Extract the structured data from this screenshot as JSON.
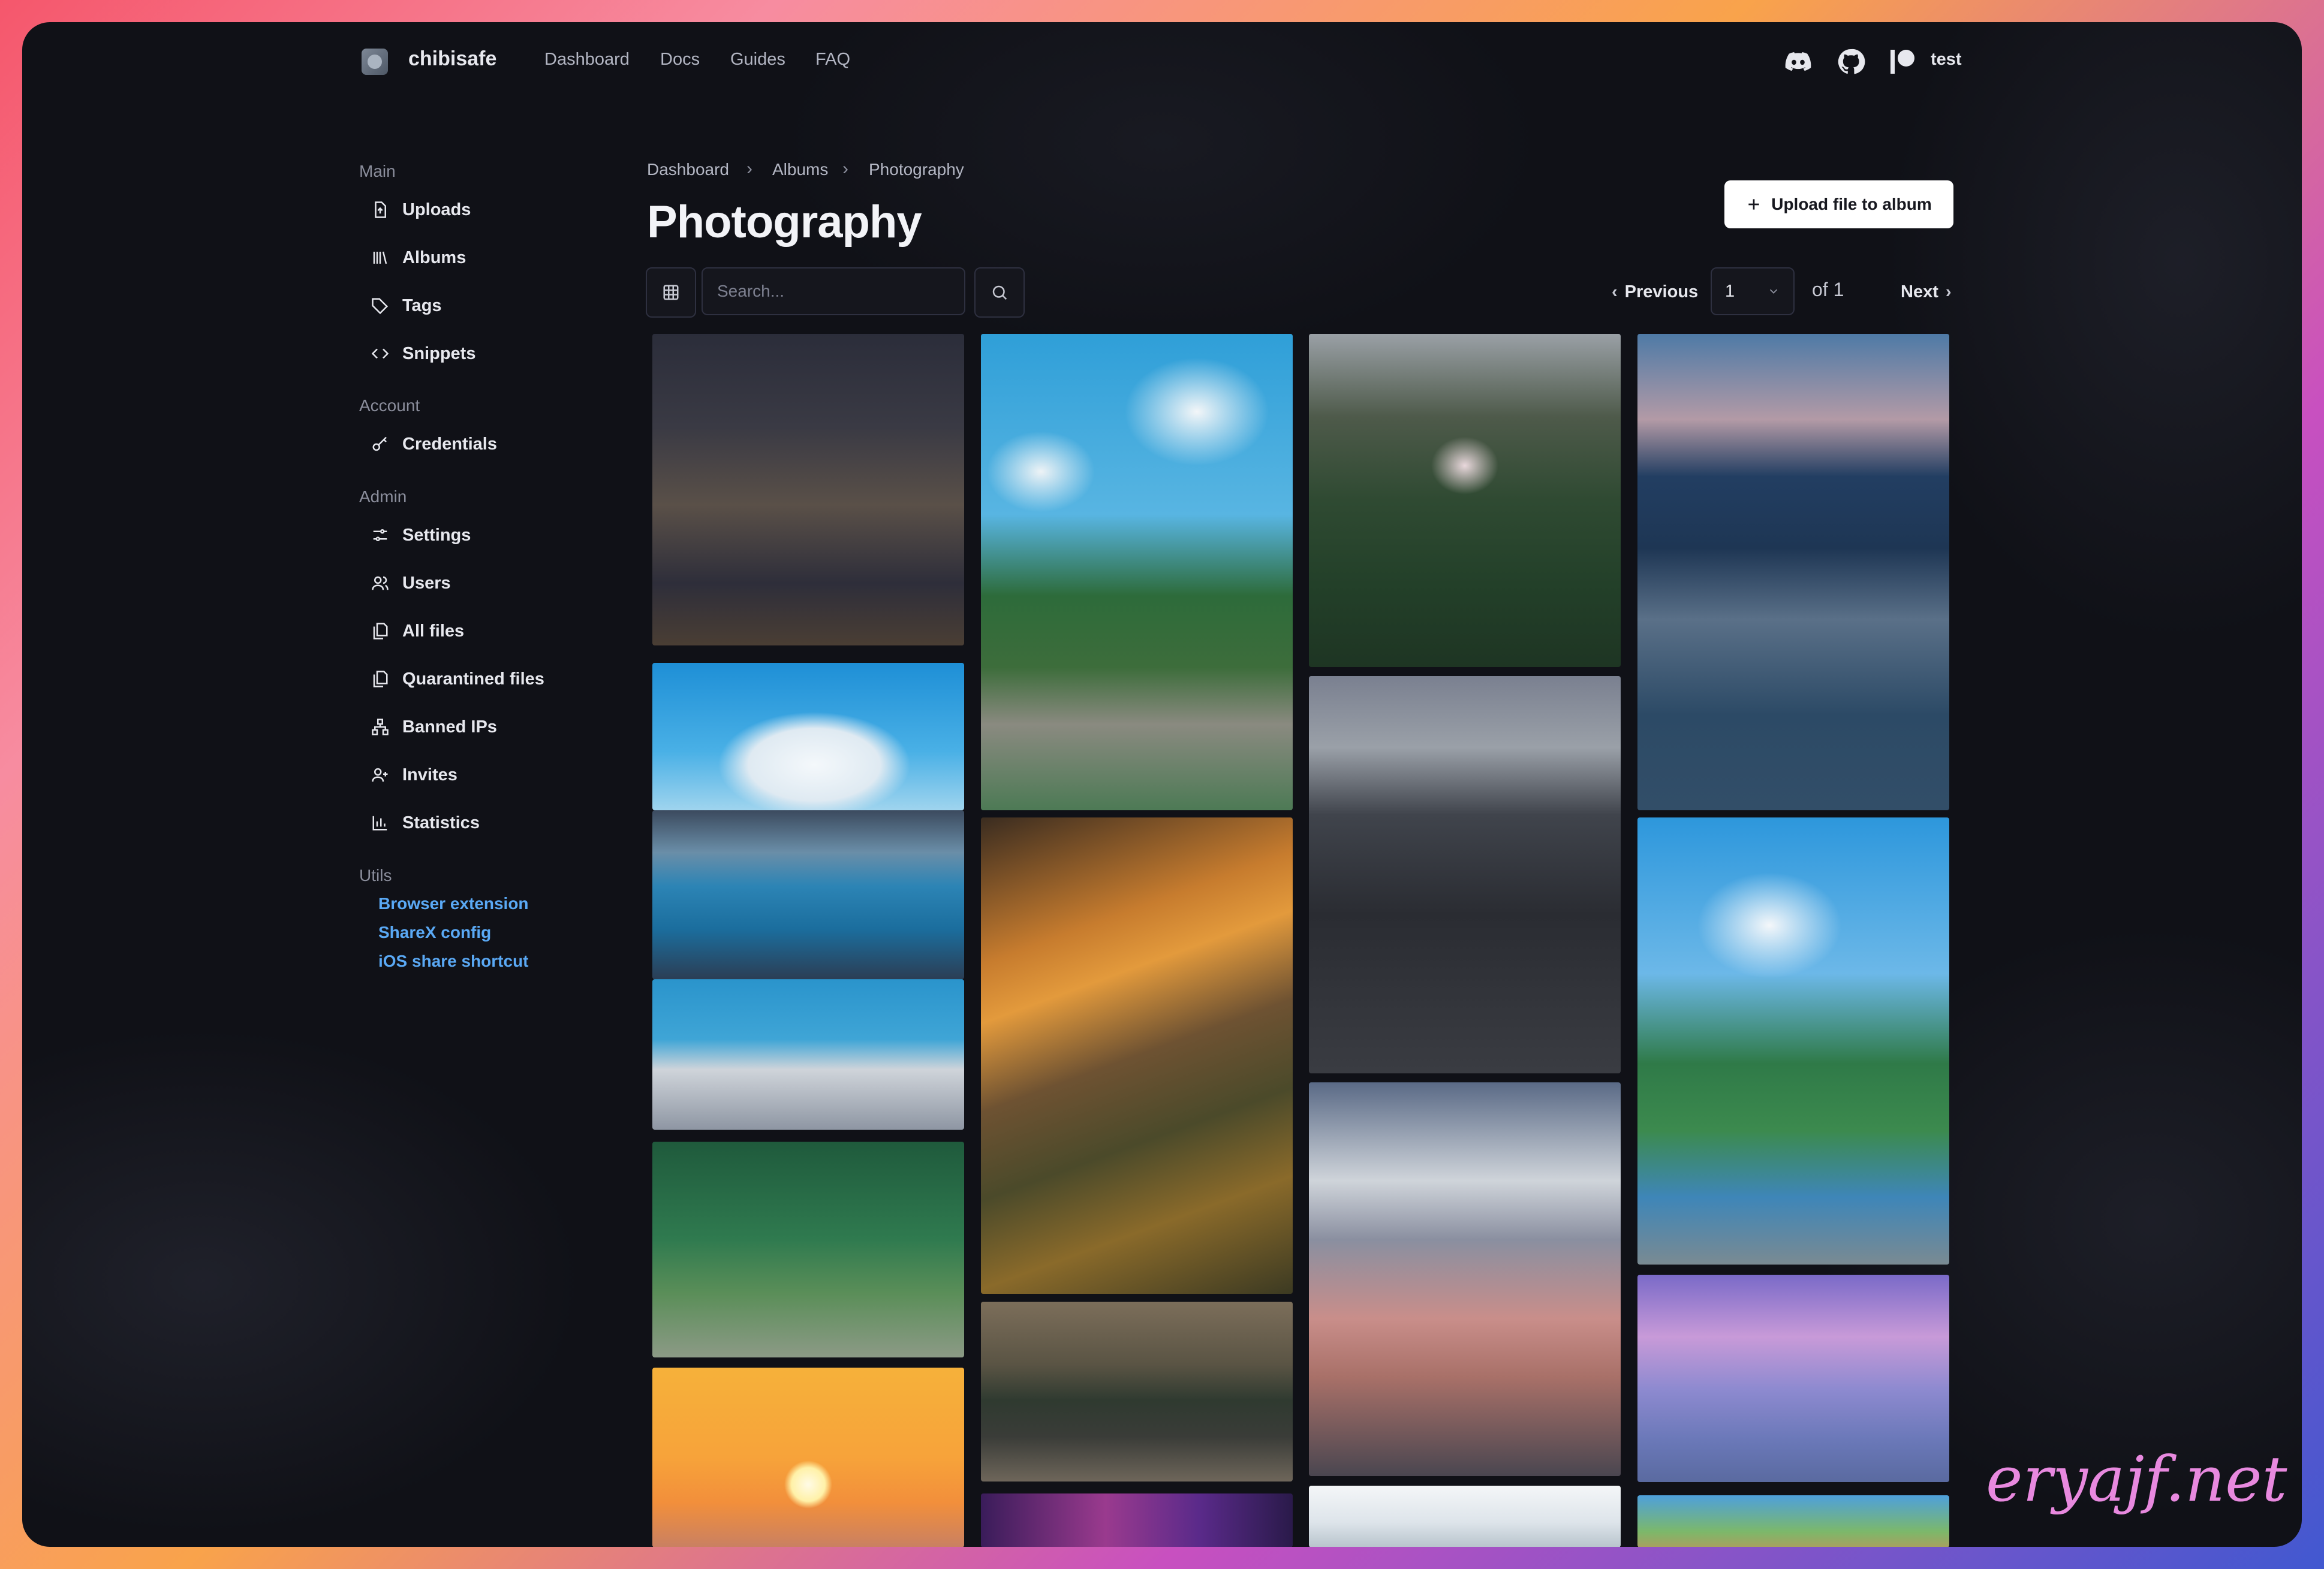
{
  "topnav": {
    "brand": "chibisafe",
    "links": [
      "Dashboard",
      "Docs",
      "Guides",
      "FAQ"
    ],
    "icons": [
      "discord-icon",
      "github-icon",
      "patreon-icon"
    ],
    "user": "test"
  },
  "sidebar": {
    "sections": [
      {
        "label": "Main",
        "items": [
          "Uploads",
          "Albums",
          "Tags",
          "Snippets"
        ]
      },
      {
        "label": "Account",
        "items": [
          "Credentials"
        ]
      },
      {
        "label": "Admin",
        "items": [
          "Settings",
          "Users",
          "All files",
          "Quarantined files",
          "Banned IPs",
          "Invites",
          "Statistics"
        ]
      },
      {
        "label": "Utils",
        "links": [
          "Browser extension",
          "ShareX config",
          "iOS share shortcut"
        ]
      }
    ]
  },
  "breadcrumb": [
    "Dashboard",
    "Albums",
    "Photography"
  ],
  "page": {
    "title": "Photography",
    "upload_button": "Upload file to album"
  },
  "toolbar": {
    "search_placeholder": "Search...",
    "previous": "Previous",
    "next": "Next",
    "current_page": "1",
    "total_pages_label": "of 1"
  },
  "colors": {
    "accent_link": "#5aa9f5",
    "background": "#101117",
    "button_bg": "#ffffff"
  },
  "gallery": {
    "columns": [
      [
        "bedroom-night-city",
        "cumulus-cloud-sky",
        "ferry-window-sea",
        "water-bottles-legs",
        "forest-road",
        "sunset-sun"
      ],
      [
        "village-blue-sky",
        "city-aerial-buildings",
        "desk-setup-monstera",
        "galaxy-sky"
      ],
      [
        "cherry-tree-valley",
        "rock-spire-clouds",
        "mount-fuji-street",
        "snowy-mountain"
      ],
      [
        "fuji-highway-night",
        "couple-mountain-sea",
        "cherry-blossom-railway",
        "sunny-landscape"
      ]
    ]
  },
  "watermark": "eryajf.net"
}
